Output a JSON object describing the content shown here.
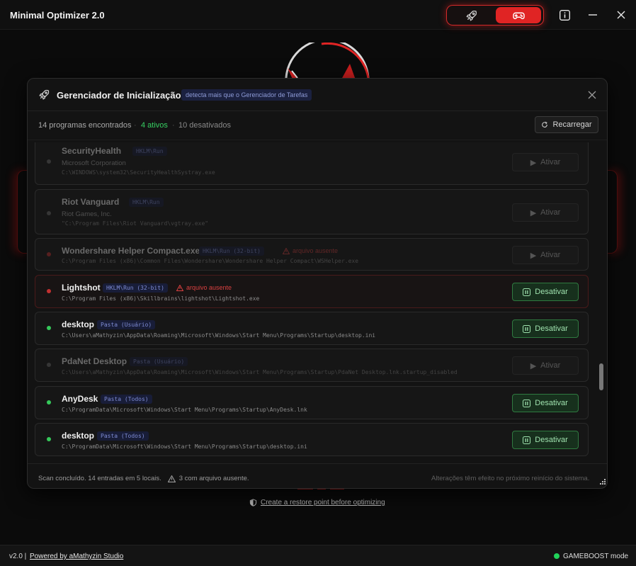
{
  "app": {
    "title": "Minimal Optimizer 2.0"
  },
  "titlebar": {
    "mode_rocket_icon": "rocket-icon",
    "mode_game_icon": "gamepad-icon",
    "info_icon": "info-icon",
    "minimize_icon": "minimize-icon",
    "close_icon": "close-icon"
  },
  "modal": {
    "title": "Gerenciador de Inicialização",
    "badge": "detecta mais que o Gerenciador de Tarefas",
    "summary": {
      "found": "14 programas encontrados",
      "active": "4 ativos",
      "disabled": "10 desativados"
    },
    "reload_label": "Recarregar",
    "rows": [
      {
        "name": "SecurityHealth",
        "tag": "HKLM\\Run",
        "publisher": "Microsoft Corporation",
        "path": "C:\\WINDOWS\\system32\\SecurityHealthSystray.exe",
        "action": "Ativar",
        "state": "disabled"
      },
      {
        "name": "Riot Vanguard",
        "tag": "HKLM\\Run",
        "publisher": "Riot Games, Inc.",
        "path": "\"C:\\Program Files\\Riot Vanguard\\vgtray.exe\"",
        "action": "Ativar",
        "state": "disabled"
      },
      {
        "name": "Wondershare Helper Compact.exe",
        "tag": "HKLM\\Run (32-bit)",
        "warning": "arquivo ausente",
        "path": "C:\\Program Files (x86)\\Common Files\\Wondershare\\Wondershare Helper Compact\\WSHelper.exe",
        "action": "Ativar",
        "state": "disabled-missing"
      },
      {
        "name": "Lightshot",
        "tag": "HKLM\\Run (32-bit)",
        "warning": "arquivo ausente",
        "path": "C:\\Program Files (x86)\\Skillbrains\\lightshot\\Lightshot.exe",
        "action": "Desativar",
        "state": "active-missing"
      },
      {
        "name": "desktop",
        "tag": "Pasta (Usuário)",
        "path": "C:\\Users\\aMathyzin\\AppData\\Roaming\\Microsoft\\Windows\\Start Menu\\Programs\\Startup\\desktop.ini",
        "action": "Desativar",
        "state": "active"
      },
      {
        "name": "PdaNet Desktop",
        "tag": "Pasta (Usuário)",
        "path": "C:\\Users\\aMathyzin\\AppData\\Roaming\\Microsoft\\Windows\\Start Menu\\Programs\\Startup\\PdaNet Desktop.lnk.startup_disabled",
        "action": "Ativar",
        "state": "disabled"
      },
      {
        "name": "AnyDesk",
        "tag": "Pasta (Todos)",
        "path": "C:\\ProgramData\\Microsoft\\Windows\\Start Menu\\Programs\\Startup\\AnyDesk.lnk",
        "action": "Desativar",
        "state": "active"
      },
      {
        "name": "desktop",
        "tag": "Pasta (Todos)",
        "path": "C:\\ProgramData\\Microsoft\\Windows\\Start Menu\\Programs\\Startup\\desktop.ini",
        "action": "Desativar",
        "state": "active"
      }
    ],
    "footer": {
      "scan": "Scan concluído. 14 entradas em 5 locais.",
      "missing": "3 com arquivo ausente.",
      "note": "Alterações têm efeito no próximo reinício do sistema."
    }
  },
  "main": {
    "restore_link": "Create a restore point before optimizing"
  },
  "statusbar": {
    "version": "v2.0 |",
    "powered": "Powered by aMathyzin Studio",
    "mode": "GAMEBOOST mode"
  },
  "colors": {
    "accent": "#e02424",
    "active": "#35c95a",
    "warning": "#d94040",
    "tag_text": "#7e8bd4"
  }
}
